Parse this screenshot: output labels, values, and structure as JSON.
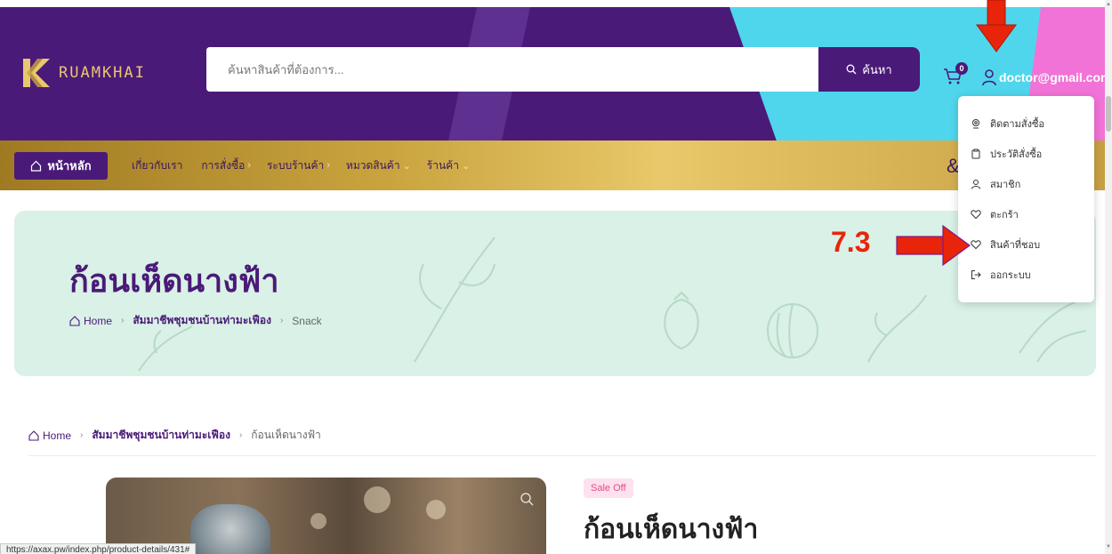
{
  "header": {
    "logo_text": "RUAMKHAI",
    "search_placeholder": "ค้นหาสินค้าที่ต้องการ...",
    "search_button": "ค้นหา",
    "cart_count": "0",
    "user_email": "doctor@gmail.com"
  },
  "nav": {
    "home": "หน้าหลัก",
    "items": [
      {
        "label": "เกี่ยวกับเรา",
        "chevron": ""
      },
      {
        "label": "การสั่งซื้อ",
        "chevron": "›"
      },
      {
        "label": "ระบบร้านค้า",
        "chevron": "›"
      },
      {
        "label": "หมวดสินค้า",
        "chevron": "⌄"
      },
      {
        "label": "ร้านค้า",
        "chevron": "⌄"
      }
    ]
  },
  "hero": {
    "title": "ก้อนเห็ดนางฟ้า",
    "breadcrumb": [
      "Home",
      "สัมมาชีพชุมชนบ้านท่ามะเฟือง",
      "Snack"
    ]
  },
  "breadcrumb2": [
    "Home",
    "สัมมาชีพชุมชนบ้านท่ามะเฟือง",
    "ก้อนเห็ดนางฟ้า"
  ],
  "product": {
    "badge": "Sale Off",
    "title": "ก้อนเห็ดนางฟ้า"
  },
  "dropdown": {
    "items": [
      {
        "label": "ติดตามสั่งซื้อ",
        "icon": "location-pin-icon"
      },
      {
        "label": "ประวัติสั่งซื้อ",
        "icon": "clipboard-icon"
      },
      {
        "label": "สมาชิก",
        "icon": "user-icon"
      },
      {
        "label": "ตะกร้า",
        "icon": "heart-icon"
      },
      {
        "label": "สินค้าที่ชอบ",
        "icon": "heart-icon"
      },
      {
        "label": "ออกระบบ",
        "icon": "logout-icon"
      }
    ]
  },
  "annotation": {
    "label": "7.3",
    "color": "#e8240b"
  },
  "status_bar": "https://axax.pw/index.php/product-details/431#",
  "colors": {
    "brand_purple": "#4a1a78",
    "gold": "#c9a43e",
    "cyan": "#4fd6ec",
    "pink": "#f273d7",
    "hero_green": "#d9f1e6"
  }
}
